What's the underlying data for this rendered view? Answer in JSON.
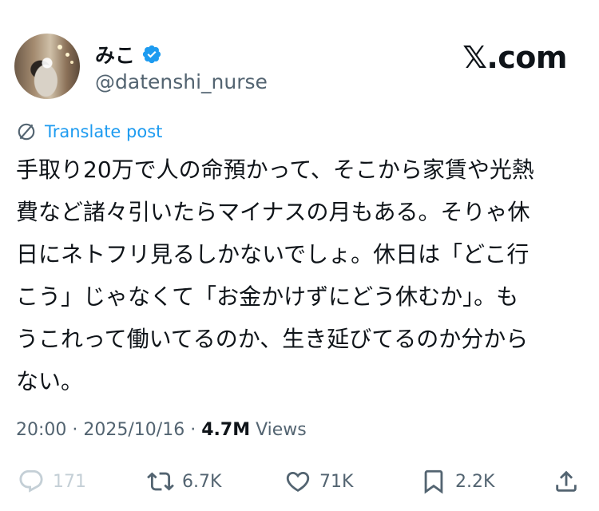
{
  "user": {
    "display_name": "みこ",
    "handle": "@datenshi_nurse"
  },
  "brand": {
    "label": "𝕏.com"
  },
  "translate": {
    "label": "Translate post"
  },
  "post": {
    "lines": [
      "手取り20万で人の命預かって、そこから家賃や光熱",
      "費など諸々引いたらマイナスの月もある。そりゃ休",
      "日にネトフリ見るしかないでしょ。休日は「どこ行",
      "こう」じゃなくて「お金かけずにどう休むか」。も",
      "うこれって働いてるのか、生き延びてるのか分から",
      "ない。"
    ]
  },
  "meta": {
    "time": "20:00",
    "date": "2025/10/16",
    "views_count": "4.7M",
    "views_label": "Views"
  },
  "actions": {
    "reply": "171",
    "repost": "6.7K",
    "like": "71K",
    "bookmark": "2.2K"
  },
  "colors": {
    "accent": "#1d9bf0",
    "text": "#0f1419",
    "muted": "#536471"
  },
  "icons": [
    "verified-badge-icon",
    "translate-icon",
    "reply-icon",
    "repost-icon",
    "like-icon",
    "bookmark-icon",
    "share-icon"
  ]
}
